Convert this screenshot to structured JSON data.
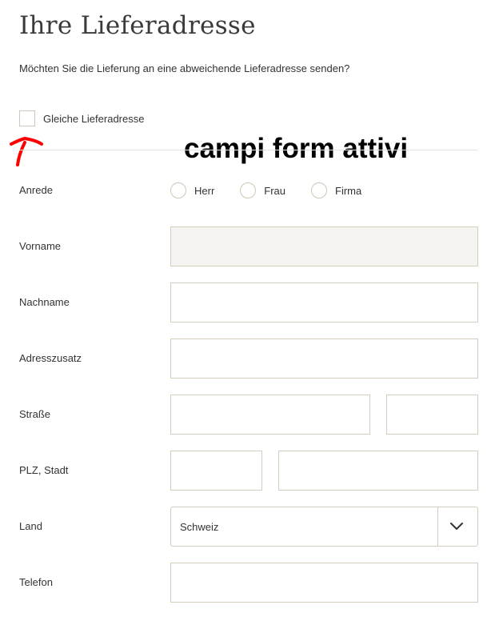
{
  "page": {
    "title": "Ihre Lieferadresse",
    "question": "Möchten Sie die Lieferung an eine abweichende Lieferadresse senden?",
    "same_address_label": "Gleiche Lieferadresse",
    "annotation": "campi form attivi",
    "annotation_arrow_color": "#ff0000"
  },
  "form": {
    "anrede_label": "Anrede",
    "salutations": [
      "Herr",
      "Frau",
      "Firma"
    ],
    "vorname_label": "Vorname",
    "nachname_label": "Nachname",
    "adresszusatz_label": "Adresszusatz",
    "strasse_label": "Straße",
    "plz_stadt_label": "PLZ, Stadt",
    "land_label": "Land",
    "land_value": "Schweiz",
    "telefon_label": "Telefon"
  },
  "colors": {
    "field_border": "#d4ccbc",
    "disabled_field_bg": "#f5f4f0",
    "text": "#333333"
  }
}
